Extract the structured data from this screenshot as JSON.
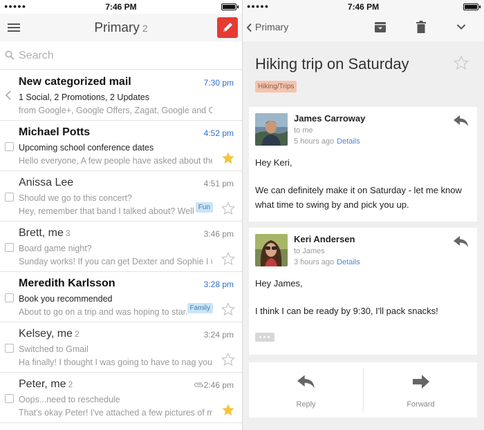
{
  "status_bar": {
    "time": "7:46 PM"
  },
  "list_header": {
    "title": "Primary",
    "count": "2"
  },
  "search": {
    "placeholder": "Search"
  },
  "mails": [
    {
      "sender": "New categorized mail",
      "count": "",
      "time": "7:30 pm",
      "subject": "1 Social, 2 Promotions, 2 Updates",
      "snippet": "from Google+, Google Offers, Zagat, Google and G...",
      "unread": true,
      "label": "",
      "starred": null
    },
    {
      "sender": "Michael Potts",
      "count": "",
      "time": "4:52 pm",
      "subject": "Upcoming school conference dates",
      "snippet": "Hello everyone, A few people have asked about the ...",
      "unread": true,
      "label": "",
      "starred": true
    },
    {
      "sender": "Anissa Lee",
      "count": "",
      "time": "4:51 pm",
      "subject": "Should we go to this concert?",
      "snippet": "Hey, remember that band I talked about? Well ...",
      "unread": false,
      "label": "Fun",
      "starred": false
    },
    {
      "sender": "Brett, me",
      "count": "3",
      "time": "3:46 pm",
      "subject": "Board game night?",
      "snippet": "Sunday works! If you can get Dexter and Sophie I wi...",
      "unread": false,
      "label": "",
      "starred": false
    },
    {
      "sender": "Meredith Karlsson",
      "count": "",
      "time": "3:28 pm",
      "subject": "Book you recommended",
      "snippet": "About to go on a trip and was hoping to star...",
      "unread": true,
      "label": "Family",
      "starred": false
    },
    {
      "sender": "Kelsey, me",
      "count": "2",
      "time": "3:24 pm",
      "subject": "Switched to Gmail",
      "snippet": "Ha finally! I thought I was going to have to nag you f...",
      "unread": false,
      "label": "",
      "starred": false
    },
    {
      "sender": "Peter, me",
      "count": "2",
      "time": "2:46 pm",
      "subject": "Oops...need to reschedule",
      "snippet": "That's okay Peter! I've attached a few pictures of m...",
      "unread": false,
      "label": "",
      "starred": true,
      "attachment": true
    }
  ],
  "detail_header": {
    "back_label": "Primary"
  },
  "thread": {
    "subject": "Hiking trip on Saturday",
    "tag": "Hiking/Trips",
    "messages": [
      {
        "from": "James Carroway",
        "to": "to me",
        "ago": "5 hours ago",
        "details": "Details",
        "greeting": "Hey Keri,",
        "body": "We can definitely make it on Saturday - let me know what time to swing by and pick you up."
      },
      {
        "from": "Keri Andersen",
        "to": "to James",
        "ago": "3 hours ago",
        "details": "Details",
        "greeting": "Hey James,",
        "body": "I think I can be ready by 9:30, I'll pack snacks!"
      }
    ],
    "actions": {
      "reply": "Reply",
      "forward": "Forward"
    }
  },
  "colors": {
    "compose": "#e53b35",
    "unread_time": "#2f6fd0",
    "star": "#f5c33b",
    "tag_bg": "#f5c4ae",
    "label_bg": "#c9e5f8",
    "link": "#4a86d6"
  }
}
